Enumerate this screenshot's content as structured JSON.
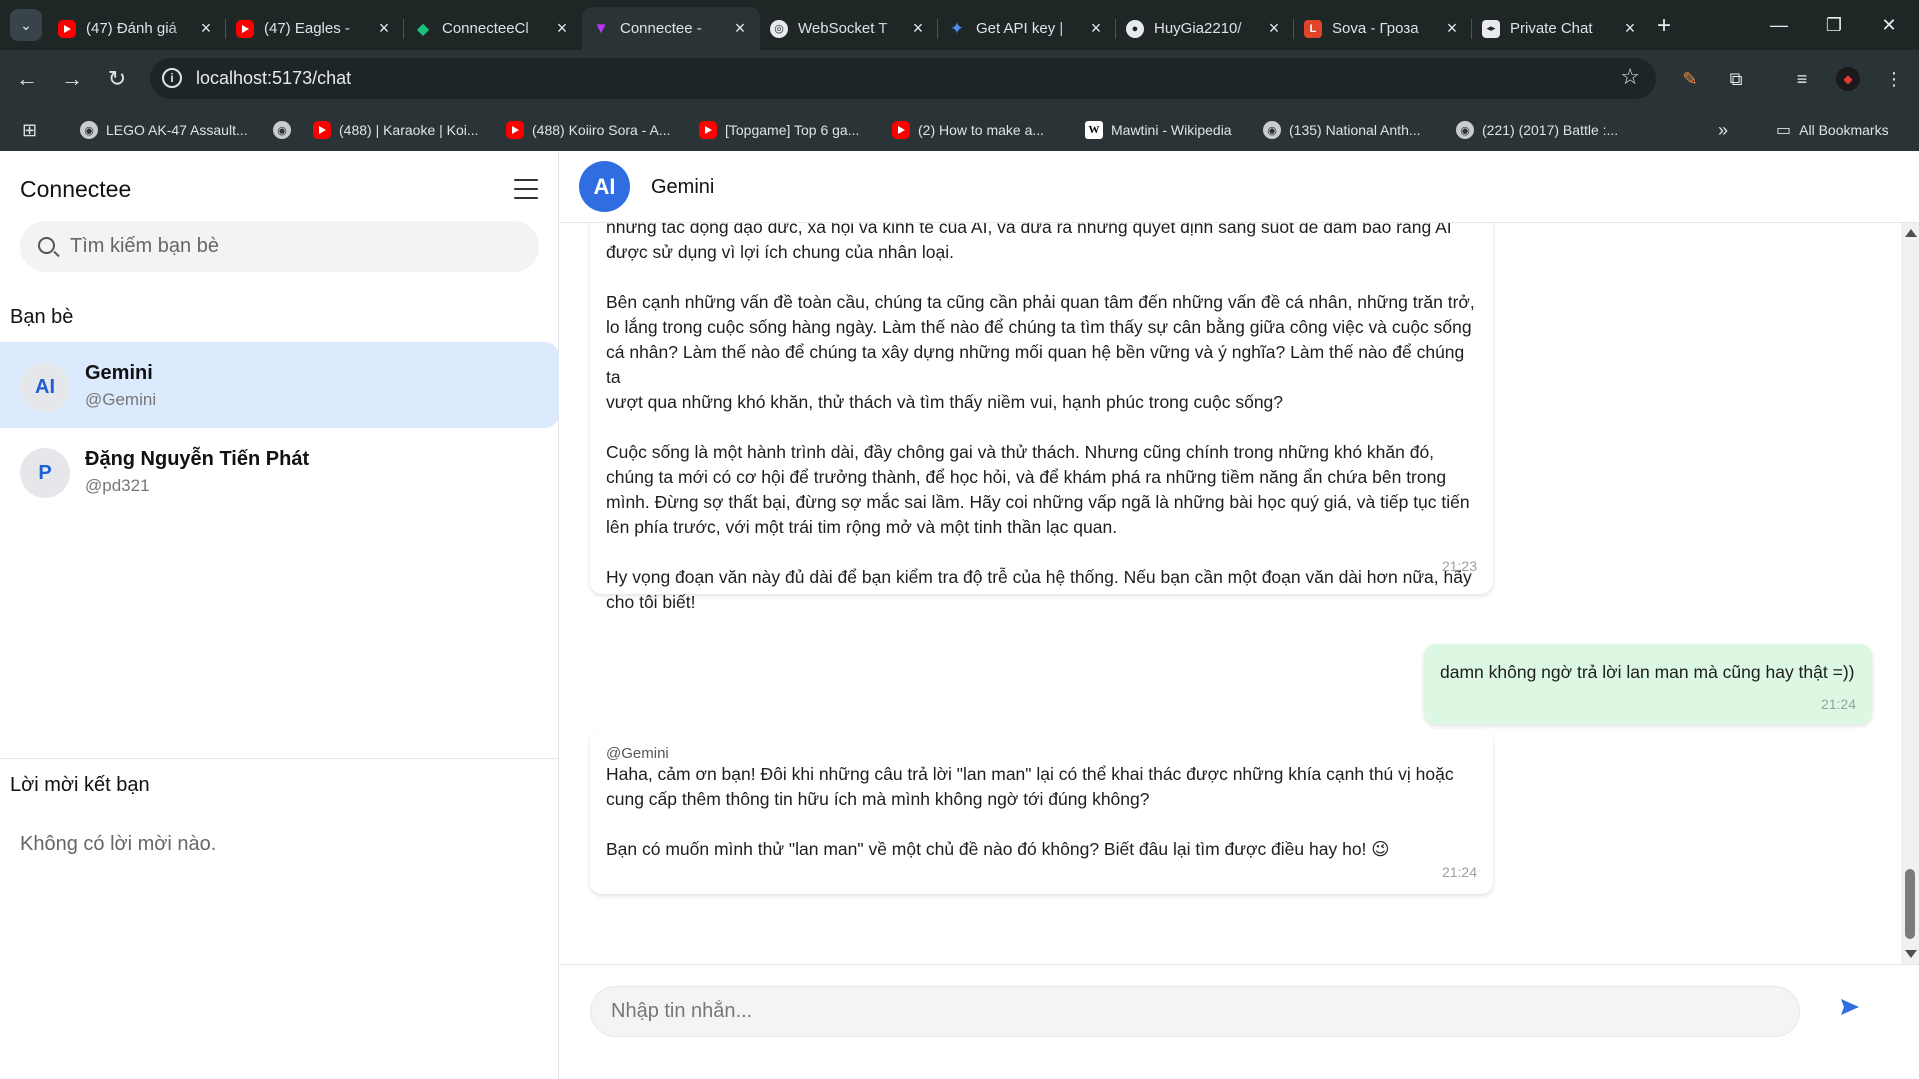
{
  "browser": {
    "tabs": [
      {
        "title": "(47) Đánh giá",
        "favicon": "youtube-icon"
      },
      {
        "title": "(47) Eagles - ",
        "favicon": "youtube-icon"
      },
      {
        "title": "ConnecteeCl",
        "favicon": "leaf-icon"
      },
      {
        "title": "Connectee - ",
        "favicon": "vite-icon",
        "active": true
      },
      {
        "title": "WebSocket T",
        "favicon": "websocket-icon"
      },
      {
        "title": "Get API key |",
        "favicon": "gemini-icon"
      },
      {
        "title": "HuyGia2210/",
        "favicon": "github-icon"
      },
      {
        "title": "Sova - Гроза",
        "favicon": "sova-icon"
      },
      {
        "title": "Private Chat ",
        "favicon": "chat-icon"
      }
    ],
    "url": "localhost:5173/chat",
    "bookmarks": [
      {
        "label": "LEGO AK-47 Assault...",
        "favicon": "globe-icon"
      },
      {
        "label": "",
        "favicon": "globe-icon"
      },
      {
        "label": "(488) | Karaoke | Koi...",
        "favicon": "youtube-icon"
      },
      {
        "label": "(488) Koiiro Sora - A...",
        "favicon": "youtube-icon"
      },
      {
        "label": "[Topgame] Top 6 ga...",
        "favicon": "youtube-icon"
      },
      {
        "label": "(2) How to make a...",
        "favicon": "youtube-icon"
      },
      {
        "label": "Mawtini - Wikipedia",
        "favicon": "wikipedia-icon"
      },
      {
        "label": "(135) National Anth...",
        "favicon": "globe-icon"
      },
      {
        "label": "(221) (2017) Battle :...",
        "favicon": "globe-icon"
      }
    ],
    "all_bookmarks_label": "All Bookmarks",
    "wiki_glyph": "W"
  },
  "sidebar": {
    "brand": "Connectee",
    "search_placeholder": "Tìm kiếm bạn bè",
    "friends_title": "Bạn bè",
    "friends": [
      {
        "initials": "AI",
        "name": "Gemini",
        "handle": "@Gemini",
        "active": true
      },
      {
        "initials": "P",
        "name": "Đặng Nguyễn Tiến Phát",
        "handle": "@pd321",
        "active": false
      }
    ],
    "invites_title": "Lời mời kết bạn",
    "invites_empty": "Không có lời mời nào."
  },
  "chat": {
    "contact": {
      "initials": "AI",
      "name": "Gemini"
    },
    "messages": [
      {
        "from": "Gemini",
        "partial_top": "những tác động đạo đức, xã hội và kinh tế của AI, và đưa ra những quyết định sáng suốt để đảm bảo rằng AI",
        "text": "được sử dụng vì lợi ích chung của nhân loại.\n\nBên cạnh những vấn đề toàn cầu, chúng ta cũng cần phải quan tâm đến những vấn đề cá nhân, những trăn trở,\nlo lắng trong cuộc sống hàng ngày. Làm thế nào để chúng ta tìm thấy sự cân bằng giữa công việc và cuộc sống\ncá nhân? Làm thế nào để chúng ta xây dựng những mối quan hệ bền vững và ý nghĩa? Làm thế nào để chúng ta\nvượt qua những khó khăn, thử thách và tìm thấy niềm vui, hạnh phúc trong cuộc sống?\n\nCuộc sống là một hành trình dài, đầy chông gai và thử thách. Nhưng cũng chính trong những khó khăn đó,\nchúng ta mới có cơ hội để trưởng thành, để học hỏi, và để khám phá ra những tiềm năng ẩn chứa bên trong\nmình. Đừng sợ thất bại, đừng sợ mắc sai lầm. Hãy coi những vấp ngã là những bài học quý giá, và tiếp tục tiến\nlên phía trước, với một trái tim rộng mở và một tinh thần lạc quan.\n\nHy vọng đoạn văn này đủ dài để bạn kiểm tra độ trễ của hệ thống. Nếu bạn cần một đoạn văn dài hơn nữa, hãy\ncho tôi biết!",
        "time": "21:23"
      },
      {
        "from": "me",
        "text": "damn không ngờ trả lời lan man mà cũng hay thật =))",
        "time": "21:24"
      },
      {
        "from": "Gemini",
        "sender_label": "@Gemini",
        "text": "Haha, cảm ơn bạn! Đôi khi những câu trả lời \"lan man\" lại có thể khai thác được những khía cạnh thú vị hoặc\ncung cấp thêm thông tin hữu ích mà mình không ngờ tới đúng không?\n\nBạn có muốn mình thử \"lan man\" về một chủ đề nào đó không? Biết đâu lại tìm được điều hay ho! 😉",
        "time": "21:24"
      }
    ],
    "input_placeholder": "Nhập tin nhắn..."
  },
  "colors": {
    "accent": "#2f6de0",
    "active_friend_bg": "#dceafd",
    "my_bubble_bg": "#dcf8e3",
    "chrome_bg": "#2a3436"
  }
}
